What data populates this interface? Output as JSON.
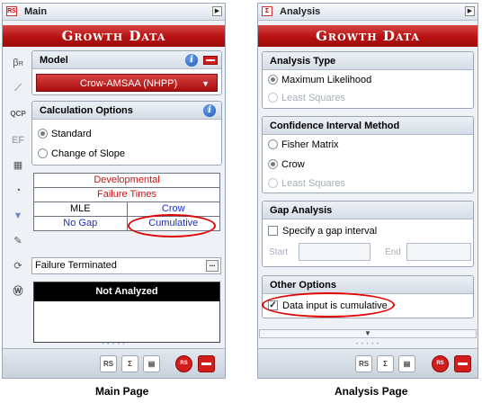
{
  "main_page": {
    "title": "Main",
    "banner": "Growth Data",
    "model": {
      "heading": "Model",
      "selected": "Crow-AMSAA (NHPP)"
    },
    "calc_options": {
      "heading": "Calculation Options",
      "options": [
        "Standard",
        "Change of Slope"
      ],
      "selected_index": 0
    },
    "summary": {
      "row1": "Developmental",
      "row2": "Failure Times",
      "row3_left": "MLE",
      "row3_right": "Crow",
      "row4_left": "No Gap",
      "row4_right": "Cumulative"
    },
    "test_type": "Failure Terminated",
    "combo_button": "...",
    "status": "Not Analyzed",
    "tools": [
      "beta-icon",
      "probability-plot-icon",
      "qcp-icon",
      "ef-icon",
      "calculator-icon",
      "gauge-icon",
      "filter-icon",
      "edit-plot-icon",
      "rs-draw-icon",
      "weibull-icon"
    ],
    "caption": "Main Page",
    "highlight_color": "#e00000",
    "accent": "#b71212"
  },
  "analysis_page": {
    "title": "Analysis",
    "banner": "Growth Data",
    "analysis_type": {
      "heading": "Analysis Type",
      "options": [
        "Maximum Likelihood",
        "Least Squares"
      ],
      "selected_index": 0
    },
    "confidence": {
      "heading": "Confidence Interval Method",
      "options": [
        "Fisher Matrix",
        "Crow",
        "Least Squares"
      ],
      "selected_index": 1
    },
    "gap": {
      "heading": "Gap Analysis",
      "checkbox_label": "Specify a gap interval",
      "checked": false,
      "start_label": "Start",
      "end_label": "End"
    },
    "other": {
      "heading": "Other Options",
      "checkbox_label": "Data input is cumulative",
      "checked": true
    },
    "caption": "Analysis Page"
  },
  "bottom_toolbar": [
    "report-icon",
    "sigma-icon",
    "plot-sheet-icon",
    "rs-icon",
    "flag-icon"
  ]
}
